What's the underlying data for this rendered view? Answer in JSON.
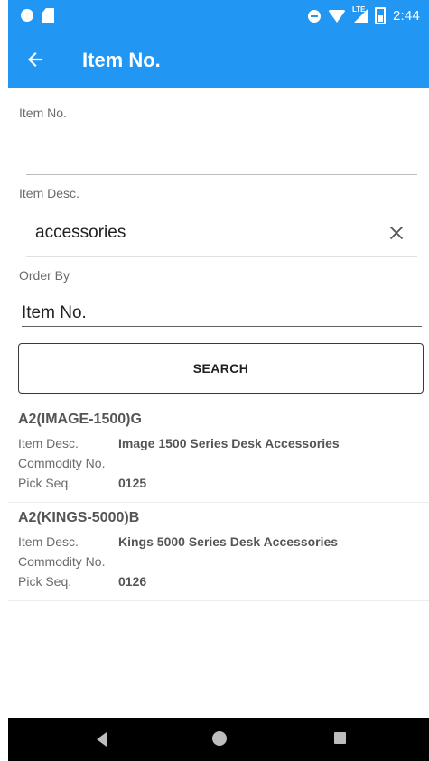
{
  "status_bar": {
    "time": "2:44",
    "network": "LTE",
    "icons": [
      "record-dot-icon",
      "sd-card-icon",
      "do-not-disturb-icon",
      "wifi-icon",
      "cell-signal-icon",
      "battery-icon"
    ]
  },
  "toolbar": {
    "title": "Item No.",
    "back_icon": "arrow-left-icon"
  },
  "form": {
    "item_no": {
      "label": "Item No.",
      "value": ""
    },
    "item_desc": {
      "label": "Item Desc.",
      "value": "accessories",
      "clear_icon": "close-icon"
    },
    "order_by": {
      "label": "Order By",
      "value": "Item No."
    },
    "search_label": "SEARCH"
  },
  "results": [
    {
      "title": "A2(IMAGE-1500)G",
      "item_desc_label": "Item Desc.",
      "item_desc": "Image 1500 Series Desk Accessories",
      "commodity_label": "Commodity No.",
      "commodity": "",
      "pick_seq_label": "Pick Seq.",
      "pick_seq": "0125"
    },
    {
      "title": "A2(KINGS-5000)B",
      "item_desc_label": "Item Desc.",
      "item_desc": "Kings 5000 Series Desk Accessories",
      "commodity_label": "Commodity No.",
      "commodity": "",
      "pick_seq_label": "Pick Seq.",
      "pick_seq": "0126"
    }
  ],
  "colors": {
    "primary": "#2196F3",
    "nav_bar": "#000000"
  }
}
